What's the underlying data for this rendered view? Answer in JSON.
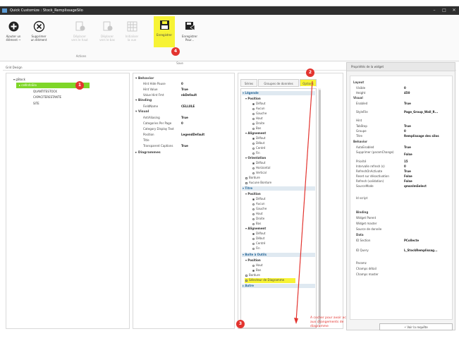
{
  "window": {
    "title": "Quick Customize : Stock_RemplissageSilo"
  },
  "ribbon": {
    "buttons": [
      {
        "label1": "Ajouter un",
        "label2": "élément ~",
        "icon": "add-icon"
      },
      {
        "label1": "Supprimer",
        "label2": "un élément",
        "icon": "delete-icon"
      },
      {
        "label1": "Déplacer",
        "label2": "vers le haut",
        "icon": "move-up-icon"
      },
      {
        "label1": "Déplacer",
        "label2": "vers le bas",
        "icon": "move-down-icon"
      },
      {
        "label1": "Initialiser",
        "label2": "la vue",
        "icon": "grid-icon"
      },
      {
        "label1": "Enregistrer",
        "label2": "",
        "icon": "save-icon"
      },
      {
        "label1": "Enregistrer",
        "label2": "Pour...",
        "icon": "save-as-icon"
      }
    ],
    "group_actions": "Actions",
    "group_save": "Save"
  },
  "badges": {
    "b1": "1",
    "b2": "2",
    "b3": "3",
    "b4": "4"
  },
  "edit_label": "Grid Design",
  "tree": {
    "root": "gStock",
    "items": [
      "cellInfoSilo",
      "QUANTITESTOCK",
      "CAPACITERESTANTE",
      "SITE"
    ]
  },
  "propgrid": {
    "behavior": "Behavior",
    "behavior_rows": [
      [
        "Hint Hide Pause",
        "0"
      ],
      [
        "Hint Value",
        "True"
      ],
      [
        "Value Hint Fmt",
        "nkDefault"
      ]
    ],
    "binding": "Binding",
    "binding_rows": [
      [
        "FieldName",
        "CELLULE"
      ]
    ],
    "visual": "Visual",
    "visual_rows": [
      [
        "AntiAliasing",
        "True"
      ],
      [
        "Categories Per Page",
        "0"
      ],
      [
        "Category Display Text",
        ""
      ],
      [
        "Position",
        "LegendDefault"
      ],
      [
        "Title",
        ""
      ],
      [
        "Transparent Captions",
        "True"
      ]
    ],
    "diagrammes": "Diagrammes"
  },
  "tabs": {
    "series": "Séries",
    "groups": "Groupes de données",
    "options": "Options"
  },
  "options_tree": {
    "legende": "Légende",
    "position": "Position",
    "pos_items": [
      "Défaut",
      "Aucun",
      "Gauche",
      "Haut",
      "Droite",
      "Bas"
    ],
    "alignement": "Alignement",
    "align_items": [
      "Défaut",
      "Début",
      "Centré",
      "Fin"
    ],
    "orientation": "Orientation",
    "orient_items": [
      "Défaut",
      "Horizontal",
      "Vertical"
    ],
    "bordure": "Bordure",
    "no_border": "Aucune Bordure",
    "titre": "Titre",
    "position2": "Position",
    "pos2_items": [
      "Défaut",
      "Aucun",
      "Gauche",
      "Haut",
      "Droite",
      "Bas"
    ],
    "alignement2": "Alignement",
    "align2_items": [
      "Défaut",
      "Début",
      "Centré",
      "Fin"
    ],
    "boite": "Boîte à Outils",
    "position3": "Position",
    "pos3_items": [
      "Haut",
      "Bas"
    ],
    "bordure3": "Bordure",
    "selecteur": "Sélecteur de Diagramme",
    "autre": "Autre"
  },
  "props": {
    "header": "Propriétés de la widget",
    "layout": "Layout",
    "layout_rows": [
      [
        "Visible",
        "0"
      ],
      [
        "Height",
        "450"
      ]
    ],
    "visual": "Visual",
    "visual_rows": [
      [
        "Enabled",
        "True"
      ],
      [
        "StyleFile",
        "Page_Group_Wall_R..."
      ],
      [
        "Hint",
        ""
      ],
      [
        "TabStop",
        "True"
      ],
      [
        "Groupe",
        "0"
      ],
      [
        "Titre",
        "Remplissage des silos"
      ]
    ],
    "behavior": "Behavior",
    "behavior_rows": [
      [
        "AutoEnabled",
        "True"
      ],
      [
        "Supprimer (paramChange)",
        "False"
      ],
      [
        "Priorité",
        "15"
      ],
      [
        "Intervalle refresh (s)",
        "0"
      ],
      [
        "RefreshOnActivate",
        "True"
      ],
      [
        "Reset sur désactivation",
        "False"
      ],
      [
        "Refresh (validation)",
        "False"
      ],
      [
        "SourceMode",
        "qmsnImSelect"
      ]
    ],
    "script": "Id script",
    "binding": "Binding",
    "binding_rows": [
      "Widget Parent",
      "Widget master",
      "Source de donnée"
    ],
    "data": "Data",
    "data_rows": [
      [
        "ID Section",
        "PCollecte"
      ],
      [
        "ID Query",
        "L_StockRemplissag..."
      ]
    ],
    "extra_rows": [
      "Paramz",
      "Champs détail",
      "Champs master"
    ],
    "voir": "Voir la requête"
  },
  "annotation": "A cocher pour avoir accès aux changements de diagramme",
  "colors": {
    "highlight": "#f7f335",
    "badge": "#e3342f",
    "arrow": "#e3342f",
    "titlebar": "#2f2f2f"
  }
}
